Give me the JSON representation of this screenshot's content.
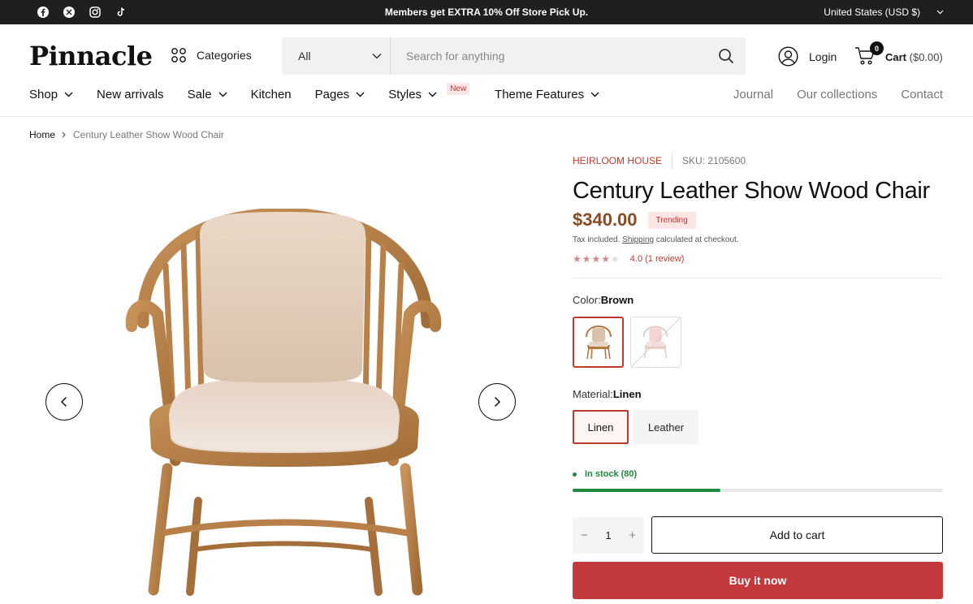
{
  "announcement": {
    "socials": [
      {
        "icon": "facebook-icon"
      },
      {
        "icon": "x-twitter-icon"
      },
      {
        "icon": "instagram-icon"
      },
      {
        "icon": "tiktok-icon"
      }
    ],
    "text": "Members get EXTRA 10% Off Store Pick Up.",
    "currency": "United States (USD $)"
  },
  "header": {
    "logo": "Pinnacle",
    "categories_label": "Categories",
    "search": {
      "category": "All",
      "placeholder": "Search for anything"
    },
    "login_label": "Login",
    "cart": {
      "count": "0",
      "label": "Cart",
      "total": "($0.00)"
    }
  },
  "nav": {
    "items": [
      {
        "label": "Shop",
        "dropdown": true
      },
      {
        "label": "New arrivals",
        "dropdown": false
      },
      {
        "label": "Sale",
        "dropdown": true
      },
      {
        "label": "Kitchen",
        "dropdown": false
      },
      {
        "label": "Pages",
        "dropdown": true
      },
      {
        "label": "Styles",
        "dropdown": true,
        "badge": "New"
      },
      {
        "label": "Theme Features",
        "dropdown": true
      }
    ],
    "right": [
      "Journal",
      "Our collections",
      "Contact"
    ]
  },
  "breadcrumb": {
    "home": "Home",
    "current": "Century Leather Show Wood Chair"
  },
  "product": {
    "vendor": "HEIRLOOM HOUSE",
    "sku": "SKU: 2105600",
    "title": "Century Leather Show Wood Chair",
    "price": "$340.00",
    "badge": "Trending",
    "tax_prefix": "Tax included.",
    "tax_link": "Shipping",
    "tax_suffix": "calculated at checkout.",
    "rating": {
      "stars": 4,
      "max": 5,
      "text": "4.0 (1 review)"
    },
    "color": {
      "label": "Color:",
      "selected": "Brown",
      "options": [
        {
          "name": "Brown",
          "active": true
        },
        {
          "name": "Pink",
          "active": false,
          "unavailable": true
        }
      ]
    },
    "material": {
      "label": "Material:",
      "selected": "Linen",
      "options": [
        "Linen",
        "Leather"
      ]
    },
    "stock": {
      "text": "In stock (80)",
      "level": 0.4
    },
    "quantity": "1",
    "add_to_cart": "Add to cart",
    "buy_now": "Buy it now"
  },
  "colors": {
    "accent": "#c4393c",
    "price": "#8a4b22",
    "stock": "#1e8a3e",
    "topbar": "#1f1f1f"
  }
}
